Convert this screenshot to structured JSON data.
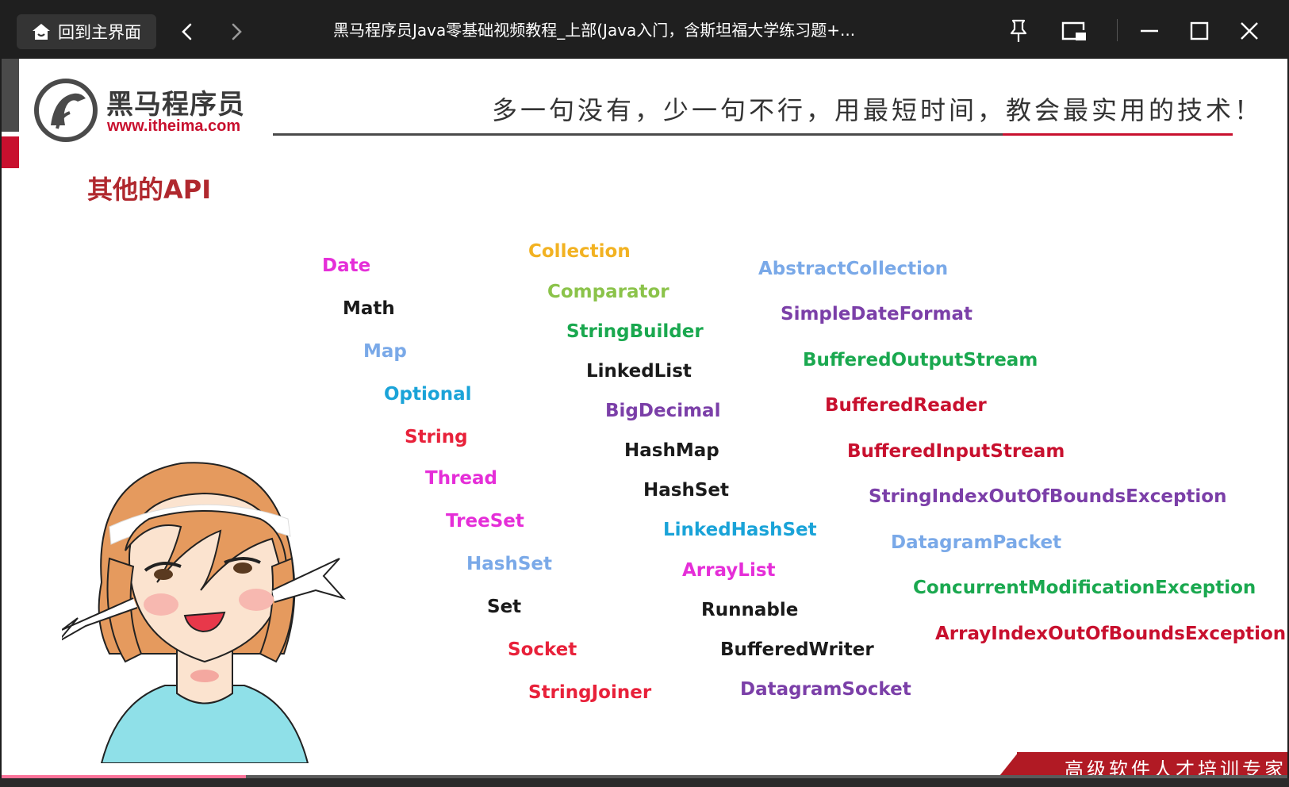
{
  "titlebar": {
    "home_label": "回到主界面",
    "window_title": "黑马程序员Java零基础视频教程_上部(Java入门，含斯坦福大学练习题+..."
  },
  "slide": {
    "logo_cn": "黑马程序员",
    "logo_url": "www.itheima.com",
    "slogan": "多一句没有，少一句不行，用最短时间，教会最实用的技术！",
    "heading": "其他的API",
    "footer": "高级软件人才培训专家"
  },
  "api_words": [
    {
      "text": "Date",
      "color": "#e52ed8"
    },
    {
      "text": "Math",
      "color": "#1a1a1a"
    },
    {
      "text": "Map",
      "color": "#7aa9e8"
    },
    {
      "text": "Optional",
      "color": "#1aa3d8"
    },
    {
      "text": "String",
      "color": "#e8213a"
    },
    {
      "text": "Thread",
      "color": "#e52ed8"
    },
    {
      "text": "TreeSet",
      "color": "#e52ed8"
    },
    {
      "text": "HashSet",
      "color": "#7aa9e8"
    },
    {
      "text": "Set",
      "color": "#1a1a1a"
    },
    {
      "text": "Socket",
      "color": "#e8213a"
    },
    {
      "text": "StringJoiner",
      "color": "#e8213a"
    },
    {
      "text": "Collection",
      "color": "#f2b222"
    },
    {
      "text": "Comparator",
      "color": "#8bc34a"
    },
    {
      "text": "StringBuilder",
      "color": "#1aa84f"
    },
    {
      "text": "LinkedList",
      "color": "#1a1a1a"
    },
    {
      "text": "BigDecimal",
      "color": "#7b3fa8"
    },
    {
      "text": "HashMap",
      "color": "#1a1a1a"
    },
    {
      "text": "HashSet",
      "color": "#1a1a1a"
    },
    {
      "text": "LinkedHashSet",
      "color": "#1aa3d8"
    },
    {
      "text": "ArrayList",
      "color": "#e52ed8"
    },
    {
      "text": "Runnable",
      "color": "#1a1a1a"
    },
    {
      "text": "BufferedWriter",
      "color": "#1a1a1a"
    },
    {
      "text": "DatagramSocket",
      "color": "#7b3fa8"
    },
    {
      "text": "AbstractCollection",
      "color": "#7aa9e8"
    },
    {
      "text": "SimpleDateFormat",
      "color": "#7b3fa8"
    },
    {
      "text": "BufferedOutputStream",
      "color": "#1aa84f"
    },
    {
      "text": "BufferedReader",
      "color": "#c8102e"
    },
    {
      "text": "BufferedInputStream",
      "color": "#c8102e"
    },
    {
      "text": "StringIndexOutOfBoundsException",
      "color": "#7b3fa8"
    },
    {
      "text": "DatagramPacket",
      "color": "#7aa9e8"
    },
    {
      "text": "ConcurrentModificationException",
      "color": "#1aa84f"
    },
    {
      "text": "ArrayIndexOutOfBoundsException",
      "color": "#c8102e"
    }
  ],
  "icons": {
    "home": "home-icon",
    "back": "chevron-left-icon",
    "forward": "chevron-right-icon",
    "pin": "pin-icon",
    "pip": "picture-in-picture-icon",
    "minimize": "minimize-icon",
    "maximize": "maximize-icon",
    "close": "close-icon"
  },
  "playback_progress": 0.19
}
